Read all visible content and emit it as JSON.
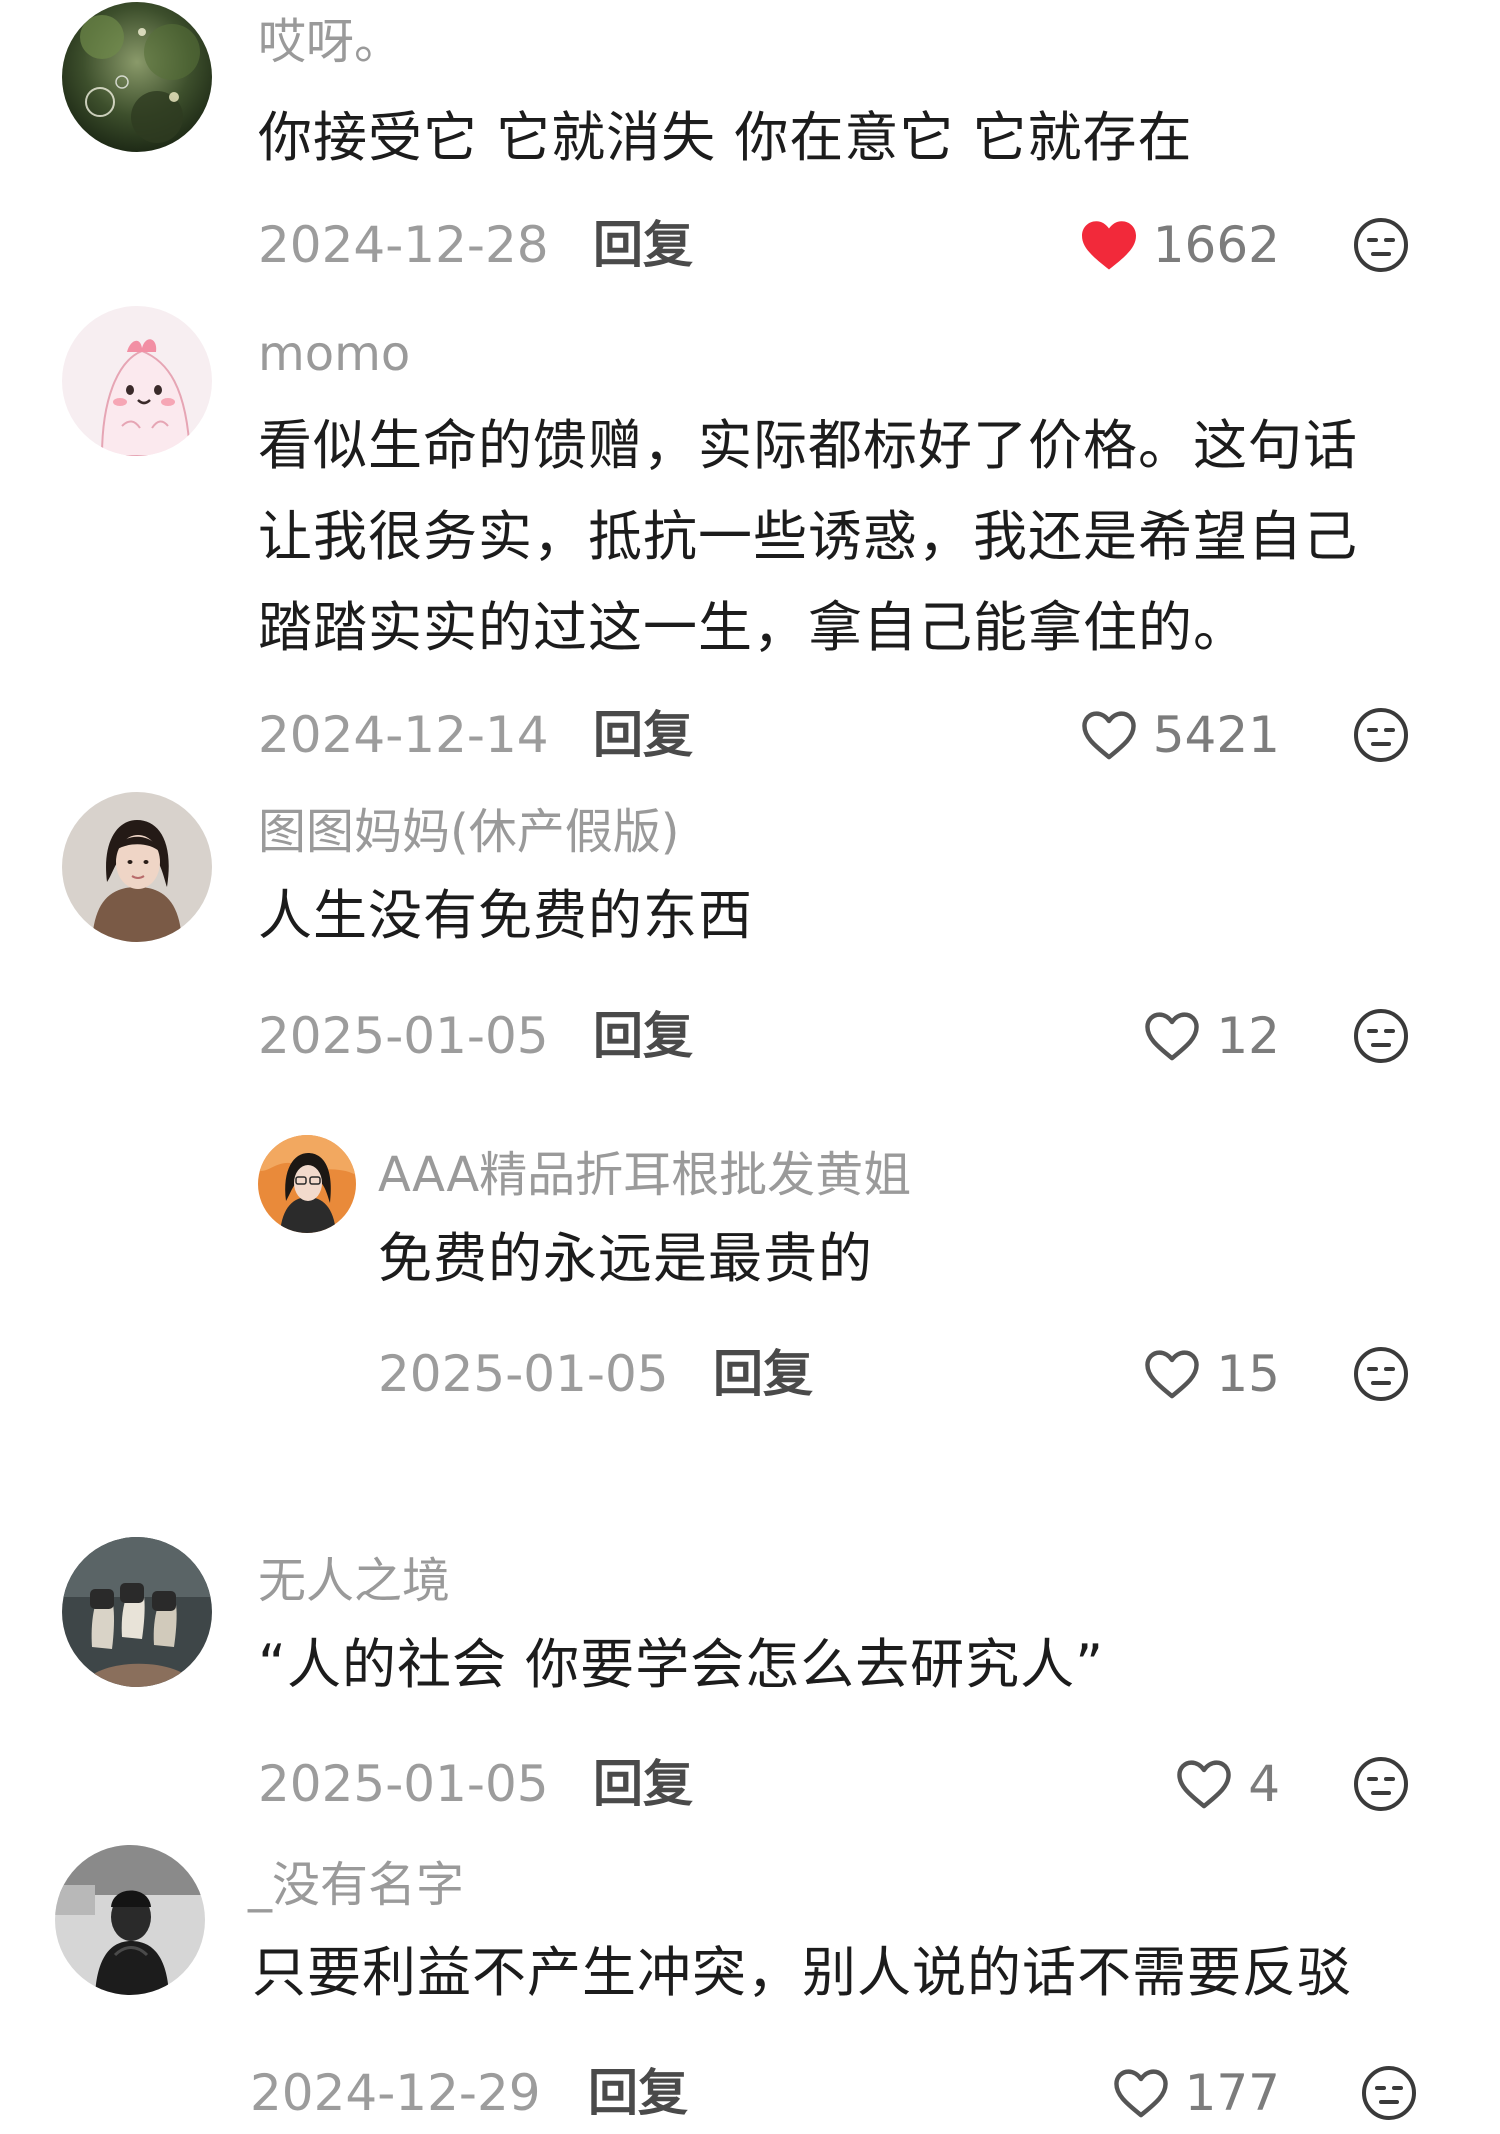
{
  "comments": [
    {
      "username": "哎呀。",
      "text_lines": [
        "你接受它 它就消失 你在意它 它就存在"
      ],
      "date": "2024-12-28",
      "reply_label": "回复",
      "likes": "1662",
      "liked": true,
      "avatar_icon": "avatar-bubbles-greenery"
    },
    {
      "username": "momo",
      "text_lines": [
        "看似生命的馈赠，实际都标好了价格。这句话",
        "让我很务实，抵抗一些诱惑，我还是希望自己",
        "踏踏实实的过这一生，拿自己能拿住的。"
      ],
      "date": "2024-12-14",
      "reply_label": "回复",
      "likes": "5421",
      "liked": false,
      "avatar_icon": "avatar-pink-cartoon"
    },
    {
      "username": "图图妈妈(休产假版)",
      "text_lines": [
        "人生没有免费的东西"
      ],
      "date": "2025-01-05",
      "reply_label": "回复",
      "likes": "12",
      "liked": false,
      "avatar_icon": "avatar-woman-portrait"
    },
    {
      "username": "AAA精品折耳根批发黄姐",
      "text_lines": [
        "免费的永远是最贵的"
      ],
      "date": "2025-01-05",
      "reply_label": "回复",
      "likes": "15",
      "liked": false,
      "avatar_icon": "avatar-woman-orange-bg"
    },
    {
      "username": "无人之境",
      "text_lines": [
        "“人的社会 你要学会怎么去研究人”"
      ],
      "date": "2025-01-05",
      "reply_label": "回复",
      "likes": "4",
      "liked": false,
      "avatar_icon": "avatar-shoes-feet"
    },
    {
      "username": "_没有名字",
      "text_lines": [
        "只要利益不产生冲突，别人说的话不需要反驳"
      ],
      "date": "2024-12-29",
      "reply_label": "回复",
      "likes": "177",
      "liked": false,
      "avatar_icon": "avatar-bw-person"
    }
  ],
  "colors": {
    "liked_heart": "#f2293a",
    "username": "#9a9a9a",
    "date": "#9c9c9c"
  }
}
